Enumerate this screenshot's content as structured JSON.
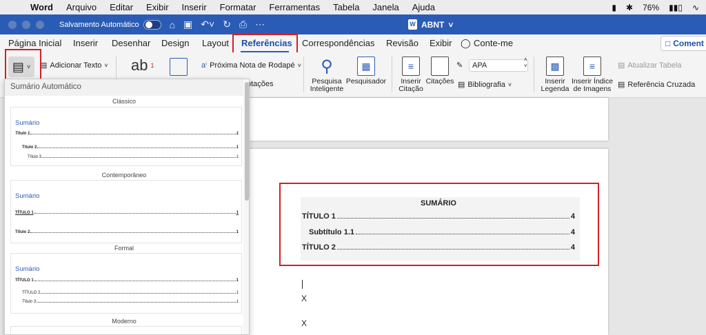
{
  "menubar": {
    "app": "Word",
    "items": [
      "Arquivo",
      "Editar",
      "Exibir",
      "Inserir",
      "Formatar",
      "Ferramentas",
      "Tabela",
      "Janela",
      "Ajuda"
    ],
    "battery": "76%"
  },
  "titlebar": {
    "autosave_label": "Salvamento Automático",
    "doc_title": "ABNT"
  },
  "tabs": [
    "Página Inicial",
    "Inserir",
    "Desenhar",
    "Design",
    "Layout",
    "Referências",
    "Correspondências",
    "Revisão",
    "Exibir",
    "Conte-me"
  ],
  "active_tab": "Referências",
  "comments_label": "Coment",
  "ribbon": {
    "add_text": "Adicionar Texto",
    "insert_footnote_icon_text": "ab",
    "next_footnote": "Próxima Nota de Rodapé",
    "show_notes": "otações",
    "smart_lookup": "Pesquisa\nInteligente",
    "researcher": "Pesquisador",
    "insert_citation": "Inserir\nCitação",
    "citations": "Citações",
    "style_value": "APA",
    "bibliography": "Bibliografia",
    "insert_caption": "Inserir\nLegenda",
    "insert_table_figures": "Inserir Índice\nde Imagens",
    "update_table": "Atualizar Tabela",
    "cross_reference": "Referência Cruzada"
  },
  "gallery": {
    "header": "Sumário Automático",
    "sections": [
      {
        "name": "Clássico",
        "title": "Sumário",
        "entries": [
          {
            "text": "Título 1",
            "page": "1"
          },
          {
            "text": "Título 2",
            "page": "1"
          },
          {
            "text": "Título 3",
            "page": "1"
          }
        ]
      },
      {
        "name": "Contemporâneo",
        "title": "Sumário",
        "entries": [
          {
            "text": "TÍTULO 1",
            "page": "1"
          },
          {
            "text": "Título 2",
            "page": "1"
          }
        ]
      },
      {
        "name": "Formal",
        "title": "Sumário",
        "entries": [
          {
            "text": "TÍTULO 1",
            "page": "1"
          },
          {
            "text": "TÍTULO 2",
            "page": "1"
          },
          {
            "text": "Título 3",
            "page": "1"
          }
        ]
      },
      {
        "name": "Moderno"
      }
    ]
  },
  "document": {
    "toc_title": "SUMÁRIO",
    "toc_entries": [
      {
        "text": "TÍTULO 1",
        "page": "4"
      },
      {
        "text": "Subtítulo 1.1",
        "page": "4"
      },
      {
        "text": "TÍTULO 2",
        "page": "4"
      }
    ],
    "body_lines": [
      "X",
      "X"
    ]
  },
  "colors": {
    "titlebar": "#2b5cb5",
    "highlight_box": "#d21f25",
    "accent_text": "#1f4fa8"
  }
}
